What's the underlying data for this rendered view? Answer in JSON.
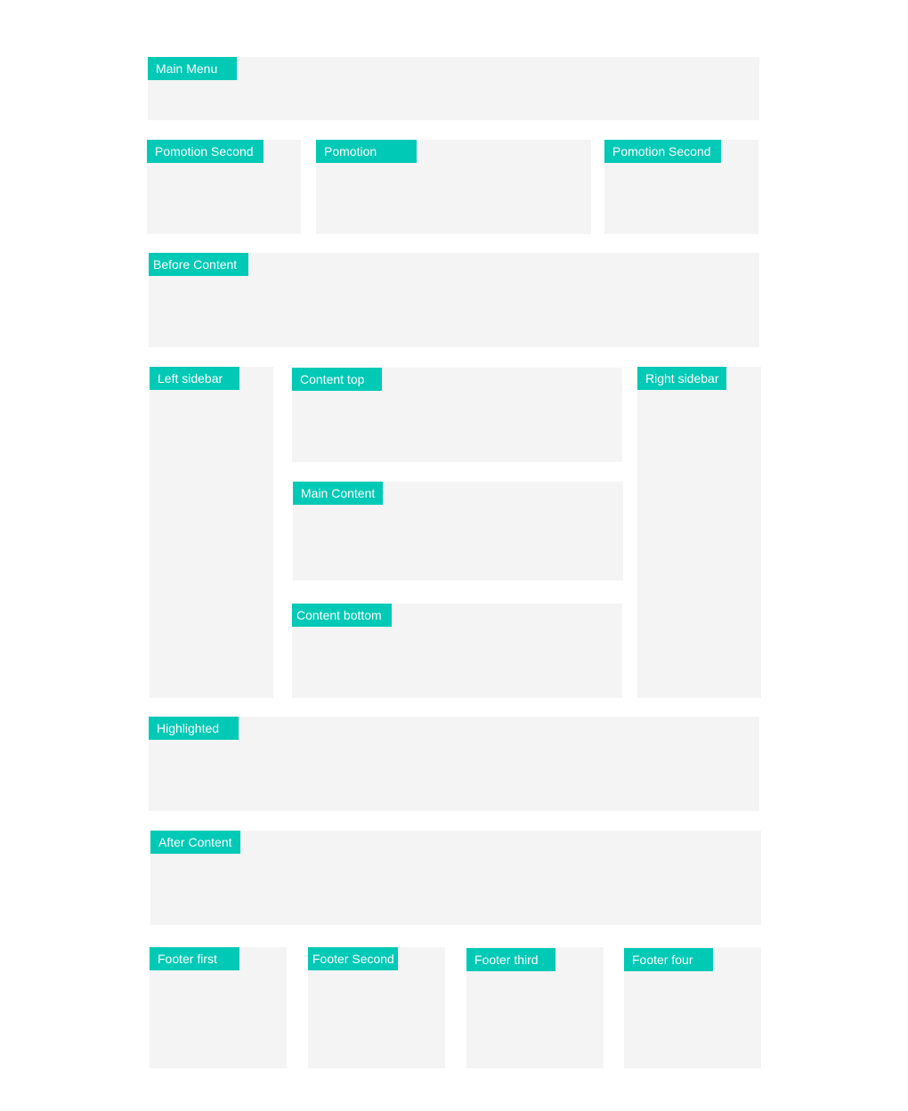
{
  "colors": {
    "region_bg": "#f4f4f4",
    "label_bg": "#00c9b5",
    "label_text": "#ffffff"
  },
  "regions": {
    "main_menu": "Main Menu",
    "promotion_second_left": "Pomotion Second",
    "promotion": "Pomotion",
    "promotion_second_right": "Pomotion Second",
    "before_content": "Before Content",
    "left_sidebar": "Left sidebar",
    "content_top": "Content top",
    "main_content": "Main Content",
    "content_bottom": "Content bottom",
    "right_sidebar": "Right sidebar",
    "highlighted": "Highlighted",
    "after_content": "After Content",
    "footer_first": "Footer first",
    "footer_second": "Footer Second",
    "footer_third": "Footer third",
    "footer_four": "Footer four"
  }
}
